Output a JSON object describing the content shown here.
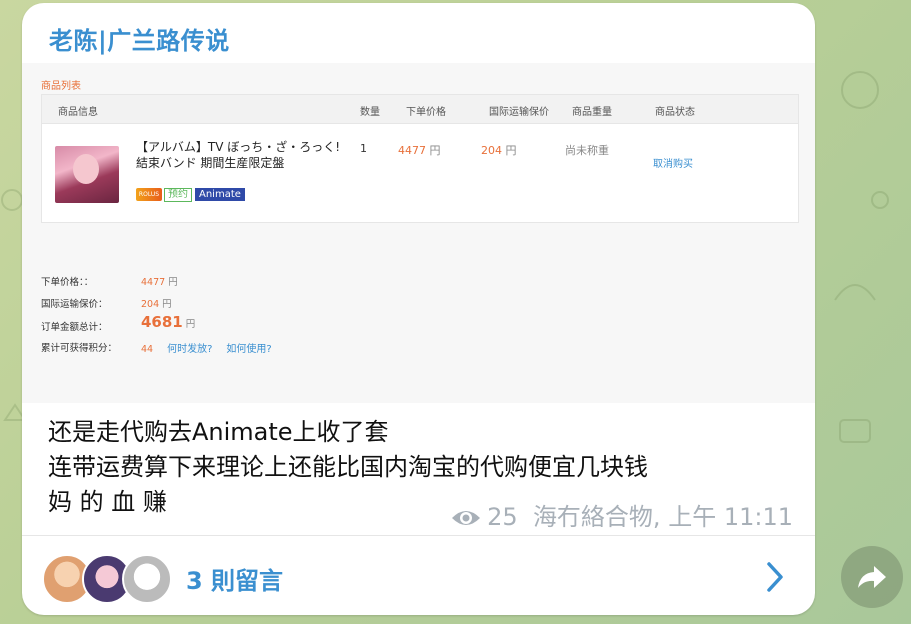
{
  "channel": {
    "sender_name": "老陈|广兰路传说"
  },
  "screenshot": {
    "section_title": "商品列表",
    "table_headers": [
      "商品信息",
      "数量",
      "下单价格",
      "国际运输保价",
      "商品重量",
      "商品状态"
    ],
    "item": {
      "name_line1": "【アルバム】TV ぼっち・ざ・ろっく!",
      "name_line2": "結束バンド 期間生産限定盤",
      "tag_logo": "ROLUS",
      "tag_preorder": "预约",
      "tag_store": "Animate",
      "quantity": "1",
      "price_value": "4477",
      "price_unit": "円",
      "shipping_value": "204",
      "shipping_unit": "円",
      "weight": "尚未称重",
      "status_action": "取消购买"
    },
    "summary": {
      "order_price_label": "下单价格：：",
      "order_price_value": "4477",
      "order_price_unit": "円",
      "shipping_label": "国际运输保价：",
      "shipping_value": "204",
      "shipping_unit": "円",
      "total_label": "订单金额总计：",
      "total_value": "4681",
      "total_unit": "円",
      "points_label": "累计可获得积分：",
      "points_value": "44",
      "points_link1": "何时发放?",
      "points_link2": "如何使用?"
    }
  },
  "message": {
    "line1": "还是走代购去Animate上收了套",
    "line2": "连带运费算下来理论上还能比国内淘宝的代购便宜几块钱",
    "line3": "妈 的 血 赚"
  },
  "meta": {
    "views": "25",
    "author_time": "海冇絡合物, 上午 11:11"
  },
  "comments": {
    "label": "3 則留言"
  },
  "colors": {
    "accent": "#3a8fd0",
    "price": "#e8703a",
    "bubble": "#ffffff"
  },
  "icons": [
    "eye-icon",
    "chevron-right-icon",
    "share-icon"
  ]
}
